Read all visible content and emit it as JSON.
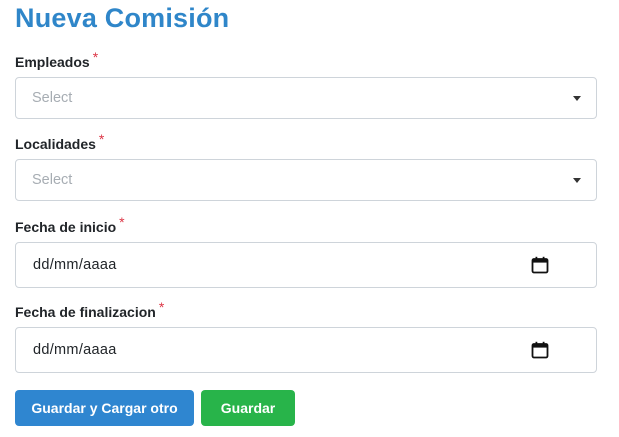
{
  "page_title": "Nueva Comisión",
  "required_mark": "*",
  "fields": {
    "empleados": {
      "label": "Empleados",
      "placeholder": "Select"
    },
    "localidades": {
      "label": "Localidades",
      "placeholder": "Select"
    },
    "fecha_inicio": {
      "label": "Fecha de inicio",
      "value": "dd/mm/aaaa"
    },
    "fecha_fin": {
      "label": "Fecha de finalizacion",
      "value": "dd/mm/aaaa"
    }
  },
  "buttons": {
    "save_and_new": "Guardar y Cargar otro",
    "save": "Guardar"
  },
  "colors": {
    "title": "#2f86c9",
    "required": "#dc3545",
    "primary_button": "#2f86d0",
    "success_button": "#28b44a"
  },
  "icons": {
    "select_caret": "caret-down-icon",
    "date_picker": "calendar-icon"
  }
}
